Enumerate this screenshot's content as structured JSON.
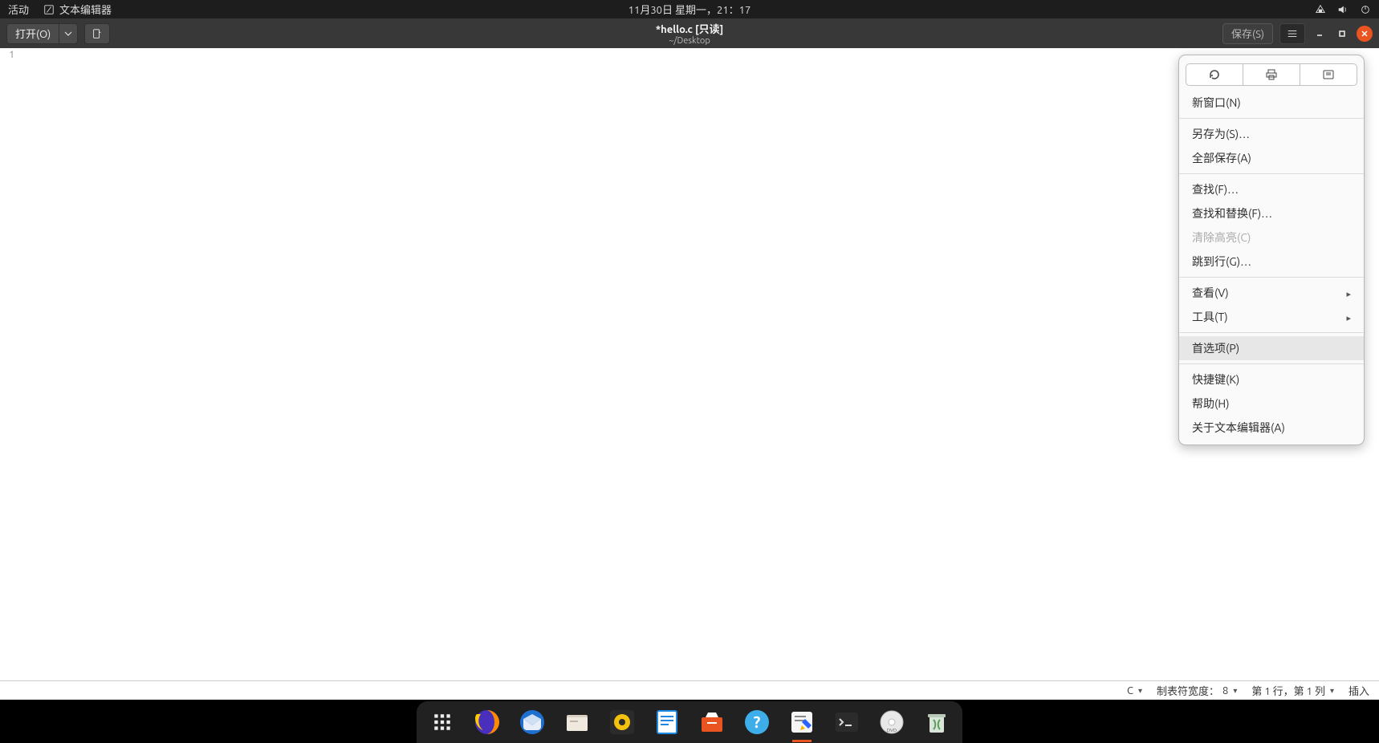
{
  "topbar": {
    "activities": "活动",
    "app_name": "文本编辑器",
    "datetime": "11月30日 星期一，21：17"
  },
  "header": {
    "open_label": "打开(O)",
    "title": "*hello.c [只读]",
    "subtitle": "~/Desktop",
    "save_label": "保存(S)"
  },
  "editor": {
    "line_number": "1"
  },
  "menu": {
    "new_window": "新窗口(N)",
    "save_as": "另存为(S)…",
    "save_all": "全部保存(A)",
    "find": "查找(F)…",
    "find_replace": "查找和替换(F)…",
    "clear_highlight": "清除高亮(C)",
    "goto_line": "跳到行(G)…",
    "view": "查看(V)",
    "tools": "工具(T)",
    "preferences": "首选项(P)",
    "shortcuts": "快捷键(K)",
    "help": "帮助(H)",
    "about": "关于文本编辑器(A)"
  },
  "statusbar": {
    "language": "C",
    "tab_width_label": "制表符宽度：",
    "tab_width_value": "8",
    "position": "第 1 行，第 1 列",
    "insert_mode": "插入"
  }
}
